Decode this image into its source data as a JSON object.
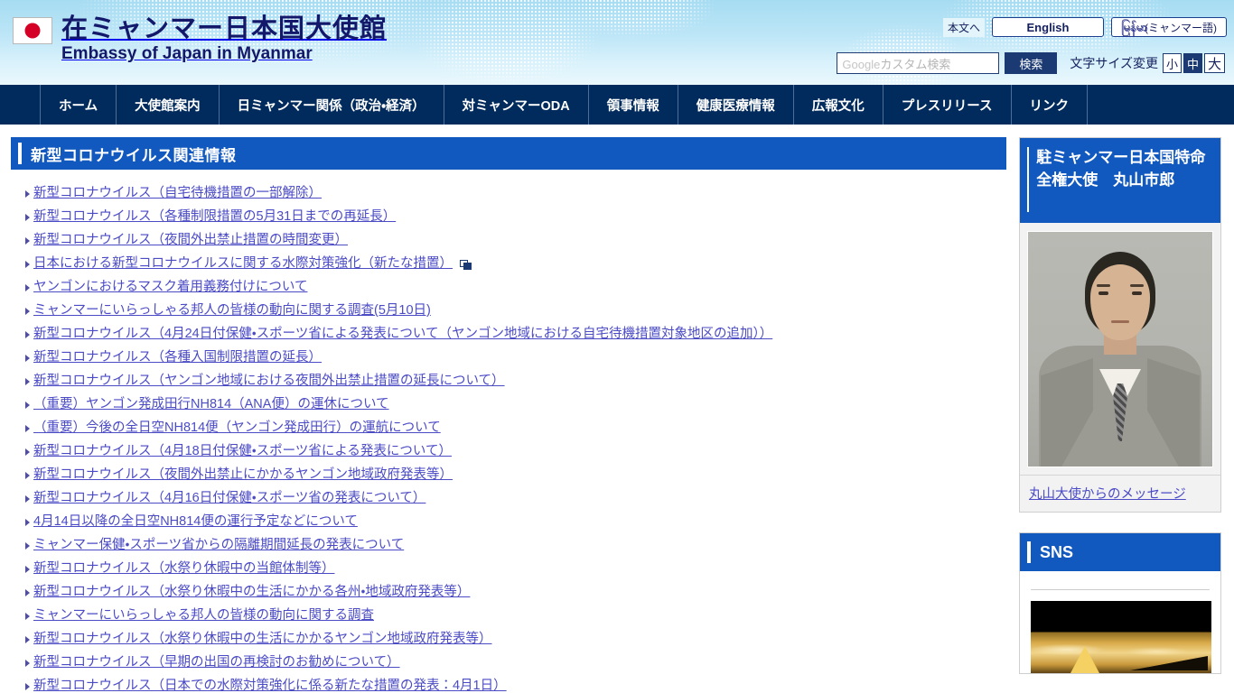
{
  "header": {
    "flag_icon": "japan-flag-icon",
    "title_ja": "在ミャンマー日本国大使館",
    "title_en": "Embassy of Japan in Myanmar",
    "skip_link": "本文へ",
    "lang_english": "English",
    "lang_myanmar_burmese": "မြန်မာ",
    "lang_myanmar_label": "(ミャンマー語)",
    "search_placeholder_google": "Google",
    "search_placeholder_rest": " カスタム検索",
    "search_button": "検索",
    "fontsize_label": "文字サイズ変更",
    "fontsize_small": "小",
    "fontsize_medium": "中",
    "fontsize_large": "大",
    "fontsize_active": "中"
  },
  "nav": {
    "items": [
      {
        "label": "ホーム"
      },
      {
        "label": "大使館案内"
      },
      {
        "label": "日ミャンマー関係（政治・経済）"
      },
      {
        "label": "対ミャンマーODA"
      },
      {
        "label": "領事情報"
      },
      {
        "label": "健康医療情報"
      },
      {
        "label": "広報文化"
      },
      {
        "label": "プレスリリース"
      },
      {
        "label": "リンク"
      }
    ]
  },
  "main": {
    "section_title": "新型コロナウイルス関連情報",
    "links": [
      {
        "label": "新型コロナウイルス（自宅待機措置の一部解除）",
        "external": false
      },
      {
        "label": "新型コロナウイルス（各種制限措置の5月31日までの再延長）",
        "external": false
      },
      {
        "label": "新型コロナウイルス（夜間外出禁止措置の時間変更）",
        "external": false
      },
      {
        "label": "日本における新型コロナウイルスに関する水際対策強化（新たな措置）",
        "external": true
      },
      {
        "label": "ヤンゴンにおけるマスク着用義務付けについて",
        "external": false
      },
      {
        "label": "ミャンマーにいらっしゃる邦人の皆様の動向に関する調査(5月10日)",
        "external": false
      },
      {
        "label": "新型コロナウイルス（4月24日付保健・スポーツ省による発表について（ヤンゴン地域における自宅待機措置対象地区の追加））",
        "external": false
      },
      {
        "label": "新型コロナウイルス（各種入国制限措置の延長）",
        "external": false
      },
      {
        "label": "新型コロナウイルス（ヤンゴン地域における夜間外出禁止措置の延長について）",
        "external": false
      },
      {
        "label": "（重要）ヤンゴン発成田行NH814（ANA便）の運休について",
        "external": false
      },
      {
        "label": "（重要）今後の全日空NH814便（ヤンゴン発成田行）の運航について",
        "external": false
      },
      {
        "label": "新型コロナウイルス（4月18日付保健・スポーツ省による発表について）",
        "external": false
      },
      {
        "label": "新型コロナウイルス（夜間外出禁止にかかるヤンゴン地域政府発表等）",
        "external": false
      },
      {
        "label": "新型コロナウイルス（4月16日付保健・スポーツ省の発表について）",
        "external": false
      },
      {
        "label": "4月14日以降の全日空NH814便の運行予定などについて",
        "external": false
      },
      {
        "label": "ミャンマー保健・スポーツ省からの隔離期間延長の発表について",
        "external": false
      },
      {
        "label": "新型コロナウイルス（水祭り休暇中の当館体制等）",
        "external": false
      },
      {
        "label": "新型コロナウイルス（水祭り休暇中の生活にかかる各州・地域政府発表等）",
        "external": false
      },
      {
        "label": "ミャンマーにいらっしゃる邦人の皆様の動向に関する調査",
        "external": false
      },
      {
        "label": "新型コロナウイルス（水祭り休暇中の生活にかかるヤンゴン地域政府発表等）",
        "external": false
      },
      {
        "label": "新型コロナウイルス（早期の出国の再検討のお勧めについて）",
        "external": false
      },
      {
        "label": "新型コロナウイルス（日本での水際対策強化に係る新たな措置の発表：4月1日）",
        "external": false
      }
    ]
  },
  "sidebar": {
    "ambassador": {
      "title": "駐ミャンマー日本国特命全権大使　丸山市郎",
      "photo_alt": "ambassador-portrait",
      "message_link": "丸山大使からのメッセージ"
    },
    "sns": {
      "title": "SNS",
      "photo_alt": "pagoda-sunset-photo"
    }
  },
  "colors": {
    "nav_bg": "#002b5c",
    "section_header": "#1158bf",
    "link": "#4b4bc6",
    "header_gradient_top": "#a6dcf2",
    "flag_red": "#d40025",
    "title_navy": "#13186b"
  }
}
